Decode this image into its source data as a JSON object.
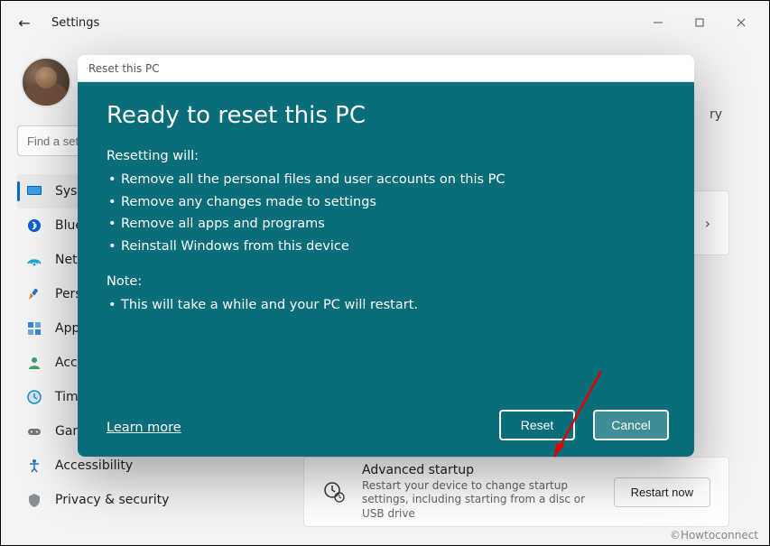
{
  "window": {
    "title": "Settings"
  },
  "search": {
    "placeholder": "Find a setting"
  },
  "right": {
    "recovery_label": "ry"
  },
  "sidebar": {
    "items": [
      {
        "label": "System",
        "icon": "system"
      },
      {
        "label": "Bluetooth & devices",
        "icon": "bluetooth"
      },
      {
        "label": "Network & internet",
        "icon": "network"
      },
      {
        "label": "Personalization",
        "icon": "personalization"
      },
      {
        "label": "Apps",
        "icon": "apps"
      },
      {
        "label": "Accounts",
        "icon": "accounts"
      },
      {
        "label": "Time & language",
        "icon": "time"
      },
      {
        "label": "Gaming",
        "icon": "gaming"
      },
      {
        "label": "Accessibility",
        "icon": "accessibility"
      },
      {
        "label": "Privacy & security",
        "icon": "privacy"
      }
    ]
  },
  "advanced": {
    "title": "Advanced startup",
    "desc": "Restart your device to change startup settings, including starting from a disc or USB drive",
    "button": "Restart now"
  },
  "dialog": {
    "header": "Reset this PC",
    "title": "Ready to reset this PC",
    "resetting_label": "Resetting will:",
    "resetting_items": [
      "Remove all the personal files and user accounts on this PC",
      "Remove any changes made to settings",
      "Remove all apps and programs",
      "Reinstall Windows from this device"
    ],
    "note_label": "Note:",
    "note_items": [
      "This will take a while and your PC will restart."
    ],
    "learn_more": "Learn more",
    "reset_button": "Reset",
    "cancel_button": "Cancel"
  },
  "watermark": "©Howtoconnect"
}
